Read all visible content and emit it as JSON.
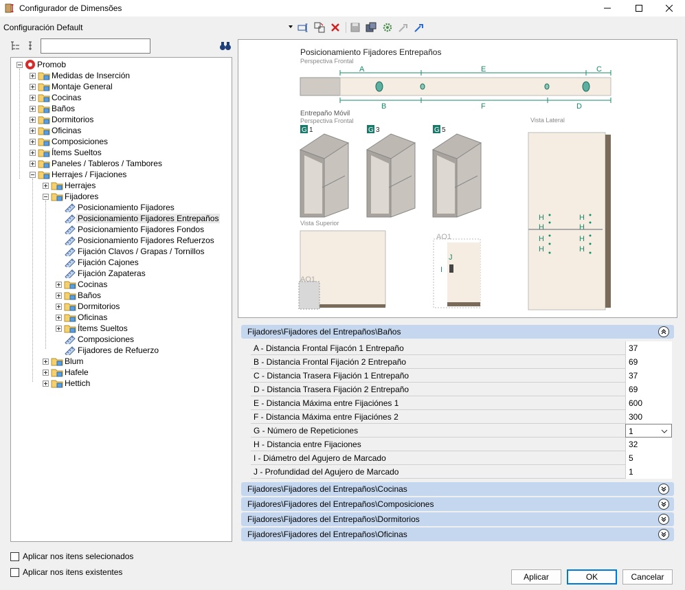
{
  "window": {
    "title": "Configurador de Dimensões"
  },
  "config": {
    "selected": "Configuración Default"
  },
  "search": {
    "value": ""
  },
  "tree": [
    {
      "label": "Promob",
      "level": 0
    },
    {
      "label": "Medidas de Inserción",
      "level": 1
    },
    {
      "label": "Montaje General",
      "level": 1
    },
    {
      "label": "Cocinas",
      "level": 1
    },
    {
      "label": "Baños",
      "level": 1
    },
    {
      "label": "Dormitorios",
      "level": 1
    },
    {
      "label": "Oficinas",
      "level": 1
    },
    {
      "label": "Composiciones",
      "level": 1
    },
    {
      "label": "Ítems Sueltos",
      "level": 1
    },
    {
      "label": "Paneles / Tableros / Tambores",
      "level": 1
    },
    {
      "label": "Herrajes / Fijaciones",
      "level": 1
    },
    {
      "label": "Herrajes",
      "level": 2
    },
    {
      "label": "Fijadores",
      "level": 2
    },
    {
      "label": "Posicionamiento Fijadores",
      "level": 3
    },
    {
      "label": "Posicionamiento Fijadores Entrepaños",
      "level": 3
    },
    {
      "label": "Posicionamiento Fijadores Fondos",
      "level": 3
    },
    {
      "label": "Posicionamiento Fijadores Refuerzos",
      "level": 3
    },
    {
      "label": "Fijación Clavos / Grapas / Tornillos",
      "level": 3
    },
    {
      "label": "Fijación Cajones",
      "level": 3
    },
    {
      "label": "Fijación Zapateras",
      "level": 3
    },
    {
      "label": "Cocinas",
      "level": 3
    },
    {
      "label": "Baños",
      "level": 3
    },
    {
      "label": "Dormitorios",
      "level": 3
    },
    {
      "label": "Oficinas",
      "level": 3
    },
    {
      "label": "Ítems Sueltos",
      "level": 3
    },
    {
      "label": "Composiciones",
      "level": 3
    },
    {
      "label": "Fijadores de Refuerzo",
      "level": 3
    },
    {
      "label": "Blum",
      "level": 2
    },
    {
      "label": "Hafele",
      "level": 2
    },
    {
      "label": "Hettich",
      "level": 2
    }
  ],
  "preview": {
    "title": "Posicionamiento Fijadores Entrepaños",
    "persp_frontal": "Perspectiva Frontal",
    "entrepano_movil": "Entrepaño Móvil",
    "persp_frontal2": "Perspectiva Frontal",
    "vista_lateral": "Vista Lateral",
    "vista_superior": "Vista Superior",
    "g": "G",
    "g1": "1",
    "g3": "3",
    "g5": "5",
    "a": "A",
    "b": "B",
    "c": "C",
    "d": "D",
    "e": "E",
    "f": "F",
    "h": "H",
    "i": "I",
    "j": "J",
    "ao1": "AO1"
  },
  "groups": {
    "banos": "Fijadores\\Fijadores del Entrepaños\\Baños",
    "cocinas": "Fijadores\\Fijadores del Entrepaños\\Cocinas",
    "composiciones": "Fijadores\\Fijadores del Entrepaños\\Composiciones",
    "dormitorios": "Fijadores\\Fijadores del Entrepaños\\Dormitorios",
    "oficinas": "Fijadores\\Fijadores del Entrepaños\\Oficinas"
  },
  "props": [
    {
      "name": "A - Distancia Frontal Fijacón 1 Entrepaño",
      "value": "37"
    },
    {
      "name": "B - Distancia Frontal Fijación 2 Entrepaño",
      "value": "69"
    },
    {
      "name": "C - Distancia Trasera Fijación 1 Entrepaño",
      "value": "37"
    },
    {
      "name": "D - Distancia Trasera Fijación 2 Entrepaño",
      "value": "69"
    },
    {
      "name": "E - Distancia Máxima entre Fijaciónes 1",
      "value": "600"
    },
    {
      "name": "F - Distancia Máxima entre Fijaciónes 2",
      "value": "300"
    },
    {
      "name": "G - Número de Repeticiones",
      "value": "1"
    },
    {
      "name": "H - Distancia entre Fijaciones",
      "value": "32"
    },
    {
      "name": "I - Diámetro del Agujero de Marcado",
      "value": "5"
    },
    {
      "name": "J - Profundidad del Agujero de Marcado",
      "value": "1"
    }
  ],
  "checks": {
    "selected": "Aplicar nos itens selecionados",
    "existing": "Aplicar nos itens existentes"
  },
  "buttons": {
    "apply": "Aplicar",
    "ok": "OK",
    "cancel": "Cancelar"
  }
}
